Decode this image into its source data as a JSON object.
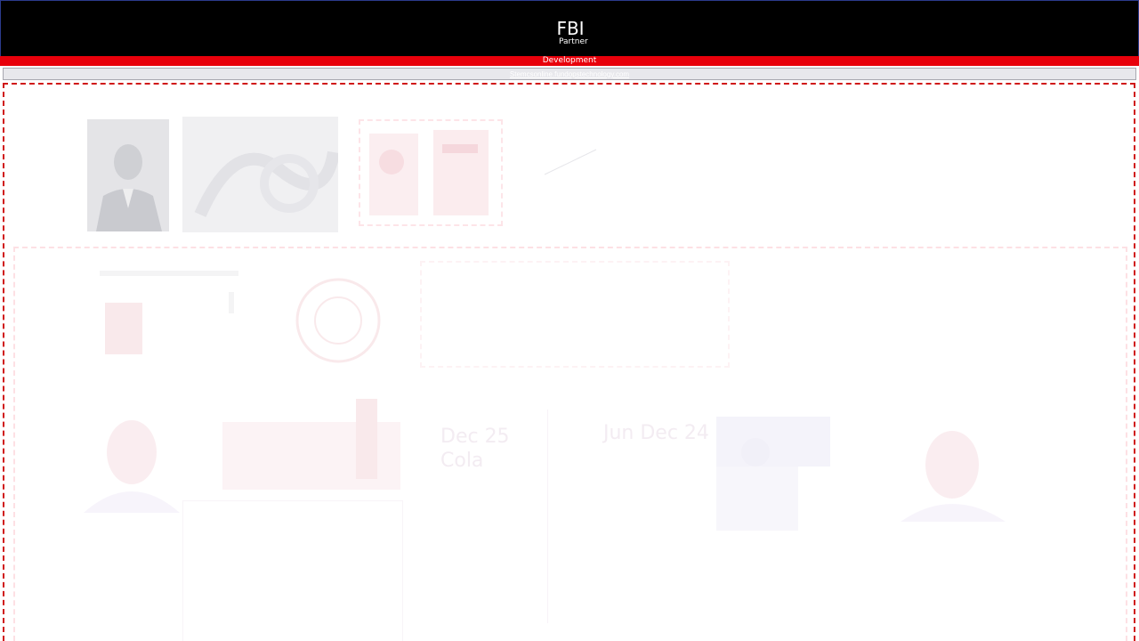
{
  "header": {
    "title": "FBI",
    "subtitle": "Partner"
  },
  "env_bar": {
    "label": "Development"
  },
  "url_bar": {
    "link_text": "Stemcsonline.fundopstechnology.com"
  },
  "canvas": {
    "faded_texts": {
      "date_a_line1": "Dec 25",
      "date_a_line2": "Cola",
      "date_b": "Jun Dec 24"
    }
  },
  "colors": {
    "header_bg": "#000000",
    "env_bar_bg": "#e8000b",
    "canvas_border": "#d01818"
  }
}
